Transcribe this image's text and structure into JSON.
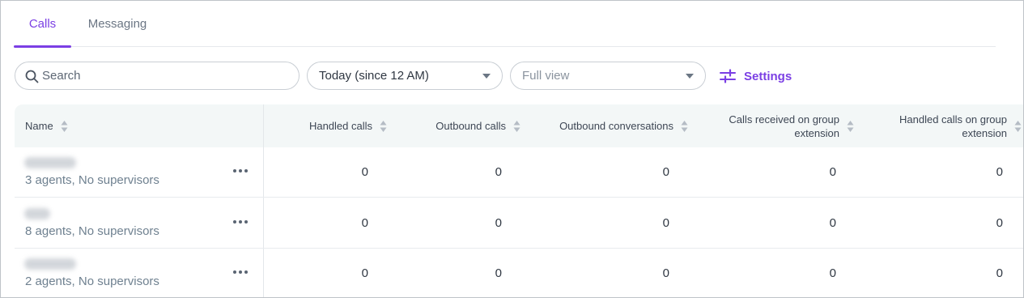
{
  "tabs": [
    {
      "label": "Calls",
      "active": true
    },
    {
      "label": "Messaging",
      "active": false
    }
  ],
  "toolbar": {
    "search": {
      "placeholder": "Search",
      "value": ""
    },
    "period": {
      "value": "Today (since 12 AM)"
    },
    "view": {
      "value": "Full view"
    },
    "settings_label": "Settings"
  },
  "table": {
    "columns": [
      {
        "label": "Name"
      },
      {
        "label": "Handled calls"
      },
      {
        "label": "Outbound calls"
      },
      {
        "label": "Outbound conversations"
      },
      {
        "label": "Calls received on group extension"
      },
      {
        "label": "Handled calls on group extension"
      }
    ],
    "rows": [
      {
        "subtitle": "3 agents, No supervisors",
        "values": [
          "0",
          "0",
          "0",
          "0",
          "0"
        ]
      },
      {
        "subtitle": "8 agents, No supervisors",
        "values": [
          "0",
          "0",
          "0",
          "0",
          "0"
        ]
      },
      {
        "subtitle": "2 agents, No supervisors",
        "values": [
          "0",
          "0",
          "0",
          "0",
          "0"
        ]
      }
    ]
  },
  "colors": {
    "accent": "#7b3fe4",
    "header_bg": "#f3f7f7",
    "muted_text": "#6f8190"
  },
  "icons": {
    "search": "search-icon",
    "dropdown": "chevron-down-icon",
    "settings": "sliders-icon",
    "sort": "sort-icon",
    "more": "more-horizontal-icon"
  }
}
